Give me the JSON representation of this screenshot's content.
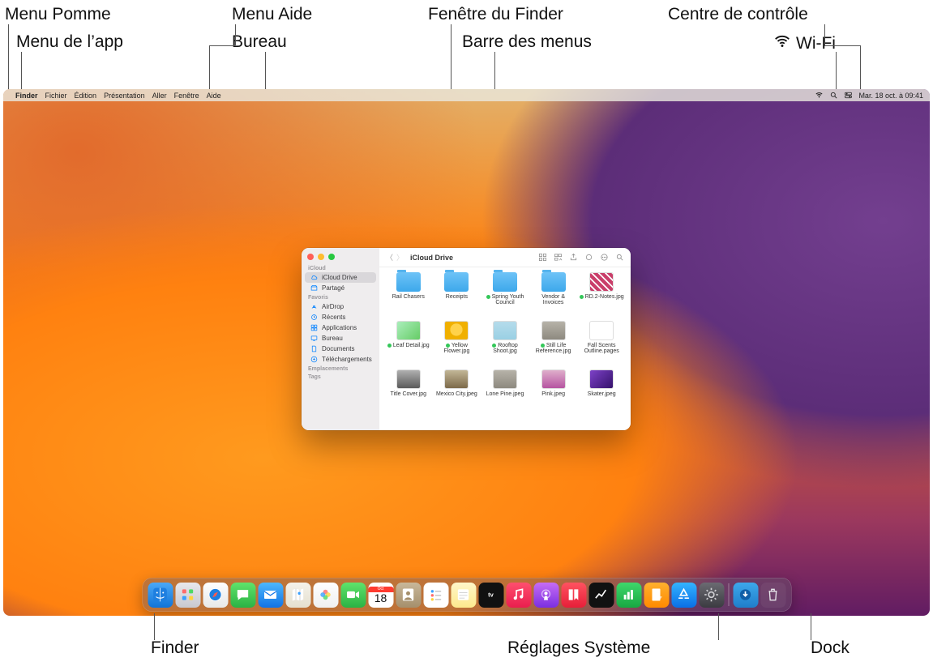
{
  "callouts": {
    "menu_pomme": "Menu Pomme",
    "menu_app": "Menu de l’app",
    "menu_aide": "Menu Aide",
    "bureau": "Bureau",
    "finder_window": "Fenêtre du Finder",
    "barre_menus": "Barre des menus",
    "centre_controle": "Centre de contrôle",
    "wifi": "Wi-Fi",
    "finder": "Finder",
    "reglages": "Réglages Système",
    "dock": "Dock"
  },
  "menubar": {
    "items": [
      "Finder",
      "Fichier",
      "Édition",
      "Présentation",
      "Aller",
      "Fenêtre",
      "Aide"
    ],
    "datetime": "Mar. 18 oct. à  09:41"
  },
  "finder": {
    "title": "iCloud Drive",
    "sidebar": {
      "section_icloud": "iCloud",
      "items_icloud": [
        {
          "label": "iCloud Drive",
          "active": true
        },
        {
          "label": "Partagé",
          "active": false
        }
      ],
      "section_favoris": "Favoris",
      "items_favoris": [
        {
          "label": "AirDrop"
        },
        {
          "label": "Récents"
        },
        {
          "label": "Applications"
        },
        {
          "label": "Bureau"
        },
        {
          "label": "Documents"
        },
        {
          "label": "Téléchargements"
        }
      ],
      "section_emplacements": "Emplacements",
      "section_tags": "Tags"
    },
    "files": [
      {
        "name": "Rail Chasers",
        "type": "folder"
      },
      {
        "name": "Receipts",
        "type": "folder"
      },
      {
        "name": "Spring Youth Council",
        "type": "folder",
        "shared": true
      },
      {
        "name": "Vendor & Invoices",
        "type": "folder"
      },
      {
        "name": "RD.2-Notes.jpg",
        "type": "imgA",
        "shared": true
      },
      {
        "name": "Leaf Detail.jpg",
        "type": "img",
        "shared": true
      },
      {
        "name": "Yellow Flower.jpg",
        "type": "img2",
        "shared": true
      },
      {
        "name": "Rooftop Shoot.jpg",
        "type": "img4",
        "shared": true
      },
      {
        "name": "Still Life Reference.jpg",
        "type": "img3",
        "shared": true
      },
      {
        "name": "Fall Scents Outline.pages",
        "type": "doc"
      },
      {
        "name": "Title Cover.jpg",
        "type": "img6"
      },
      {
        "name": "Mexico City.jpeg",
        "type": "img7"
      },
      {
        "name": "Lone Pine.jpeg",
        "type": "img3"
      },
      {
        "name": "Pink.jpeg",
        "type": "img8"
      },
      {
        "name": "Skater.jpeg",
        "type": "img9"
      }
    ]
  },
  "dock": {
    "calendar": {
      "month": "Oct",
      "day": "18"
    },
    "items": [
      {
        "id": "finder",
        "name": "Finder"
      },
      {
        "id": "launchpad",
        "name": "Launchpad"
      },
      {
        "id": "safari",
        "name": "Safari"
      },
      {
        "id": "messages",
        "name": "Messages"
      },
      {
        "id": "mail",
        "name": "Mail"
      },
      {
        "id": "maps",
        "name": "Plans"
      },
      {
        "id": "photos",
        "name": "Photos"
      },
      {
        "id": "facetime",
        "name": "FaceTime"
      },
      {
        "id": "calendar",
        "name": "Calendrier"
      },
      {
        "id": "contacts",
        "name": "Contacts"
      },
      {
        "id": "reminders",
        "name": "Rappels"
      },
      {
        "id": "notes",
        "name": "Notes"
      },
      {
        "id": "tv",
        "name": "TV"
      },
      {
        "id": "music",
        "name": "Musique"
      },
      {
        "id": "podcasts",
        "name": "Podcasts"
      },
      {
        "id": "news",
        "name": "News"
      },
      {
        "id": "stocks",
        "name": "Bourse"
      },
      {
        "id": "numbers",
        "name": "Numbers"
      },
      {
        "id": "pages",
        "name": "Pages"
      },
      {
        "id": "appstore",
        "name": "App Store"
      },
      {
        "id": "sysprefs",
        "name": "Réglages Système"
      }
    ],
    "after_sep": [
      {
        "id": "downloads",
        "name": "Téléchargements"
      },
      {
        "id": "trash",
        "name": "Corbeille"
      }
    ]
  }
}
